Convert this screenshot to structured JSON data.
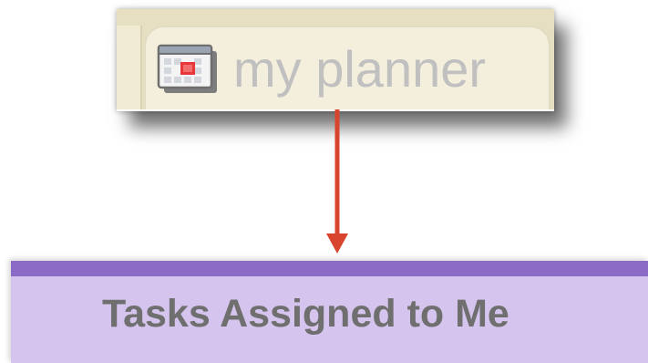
{
  "planner_tab": {
    "label": "my planner",
    "icon": "calendar-icon"
  },
  "section_header": {
    "title": "Tasks Assigned to Me"
  },
  "colors": {
    "tab_bar": "#e6dfc1",
    "tab_background": "#f3efdc",
    "tab_text": "#c0c0c0",
    "arrow": "#d9442e",
    "banner_background": "#d5c4ee",
    "banner_stripe": "#8c6bc6",
    "banner_text": "#6f6f6f"
  }
}
